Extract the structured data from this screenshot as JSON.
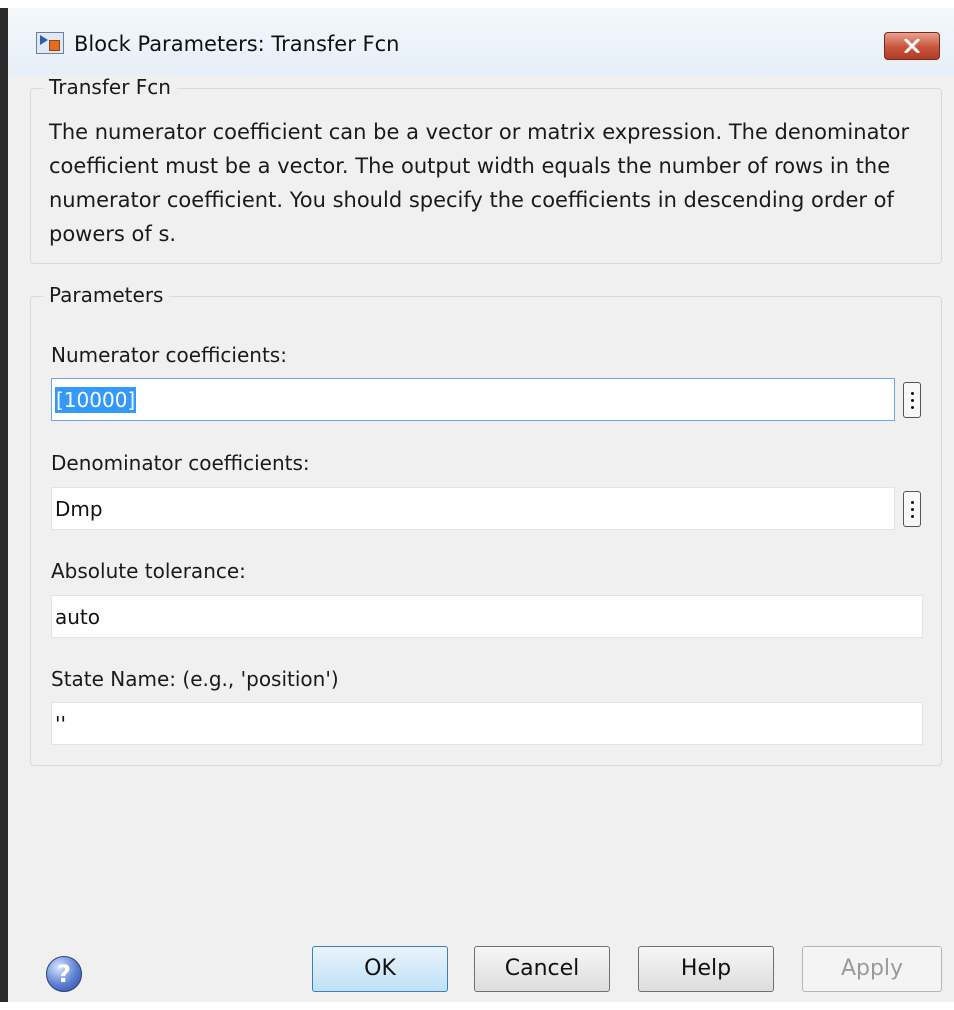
{
  "window": {
    "title": "Block Parameters: Transfer Fcn",
    "close_icon": "close-icon"
  },
  "description_group": {
    "legend": "Transfer Fcn",
    "text": "The numerator coefficient can be a vector or matrix expression. The denominator coefficient must be a vector. The output width equals the number of rows in the numerator coefficient. You should specify the coefficients in descending order of powers of s."
  },
  "parameters_group": {
    "legend": "Parameters",
    "numerator": {
      "label": "Numerator coefficients:",
      "value": "[10000]"
    },
    "denominator": {
      "label": "Denominator coefficients:",
      "value": "Dmp"
    },
    "abs_tol": {
      "label": "Absolute tolerance:",
      "value": "auto"
    },
    "state_name": {
      "label": "State Name: (e.g., 'position')",
      "value": "''"
    }
  },
  "buttons": {
    "help_icon_glyph": "?",
    "ok": "OK",
    "cancel": "Cancel",
    "help": "Help",
    "apply": "Apply"
  },
  "colors": {
    "selection": "#3399ff",
    "close_button": "#c9543b",
    "default_button": "#bfe0f7"
  }
}
